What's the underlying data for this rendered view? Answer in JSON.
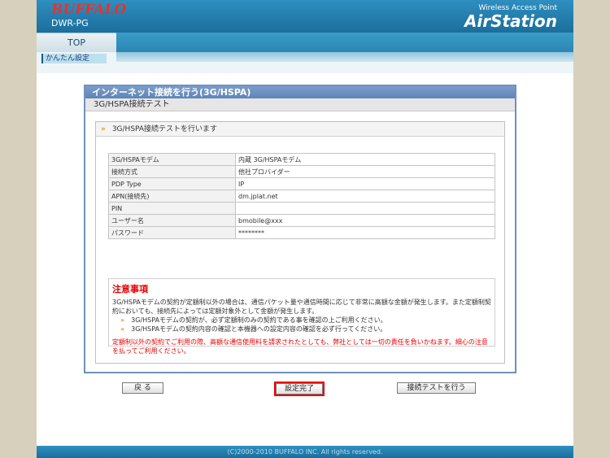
{
  "header": {
    "logo_text": "BUFFALO",
    "model": "DWR-PG",
    "brand_sub": "Wireless Access Point",
    "brand": "AirStation"
  },
  "nav": {
    "top_tab": "TOP",
    "subnav_item": "かんたん設定"
  },
  "panel": {
    "title": "インターネット接続を行う(3G/HSPA)",
    "step": "3G/HSPA接続テスト",
    "section_label": "3G/HSPA接続テストを行います",
    "rows": [
      {
        "k": "3G/HSPAモデム",
        "v": "内蔵 3G/HSPAモデム"
      },
      {
        "k": "接続方式",
        "v": "他社プロバイダー"
      },
      {
        "k": "PDP Type",
        "v": "IP"
      },
      {
        "k": "APN(接続先)",
        "v": "dm.jplat.net"
      },
      {
        "k": "PIN",
        "v": ""
      },
      {
        "k": "ユーザー名",
        "v": "bmobile@xxx"
      },
      {
        "k": "パスワード",
        "v": "********"
      }
    ],
    "caution": {
      "title": "注意事項",
      "desc": "3G/HSPAモデムの契約が定額制以外の場合は、通信パケット量や通信時間に応じて非常に高額な金額が発生します。また定額制契約においても、接続先によっては定額対象外として金額が発生します。",
      "items": [
        "3G/HSPAモデムの契約が、必ず定額制のみの契約である事を確認の上ご利用ください。",
        "3G/HSPAモデムの契約内容の確認と本機器への設定内容の確認を必ず行ってください。"
      ],
      "warning": "定額制以外の契約でご利用の際、高額な通信使用料を請求されたとしても、弊社としては一切の責任を負いかねます。細心の注意を払ってご利用ください。"
    }
  },
  "buttons": {
    "back": "戻 る",
    "done": "設定完了",
    "test": "接続テストを行う"
  },
  "footer": {
    "copyright": "(C)2000-2010 BUFFALO INC. All rights reserved."
  },
  "colors": {
    "header_blue": "#1b6e9c",
    "panel_blue": "#6f91bd",
    "caution_red": "#e60000",
    "chevron_orange": "#e8901a"
  }
}
